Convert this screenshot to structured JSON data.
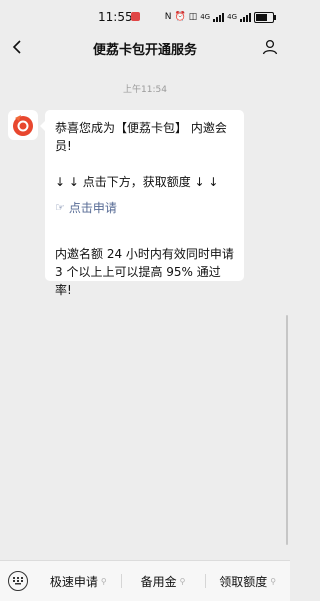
{
  "status_bar": {
    "time": "11:55",
    "network": "4G",
    "network2": "4G"
  },
  "nav": {
    "title": "便荔卡包开通服务"
  },
  "chat": {
    "timestamp": "上午11:54",
    "message": {
      "line1": "恭喜您成为【便荔卡包】 内邀会员!",
      "line2": "↓ ↓ 点击下方，获取额度 ↓ ↓",
      "link_text": "点击申请",
      "line3": "内邀名额 24 小时内有效同时申请 3 个以上上可以提高 95% 通过率!"
    }
  },
  "menu": {
    "items": [
      {
        "label": "极速申请"
      },
      {
        "label": "备用金"
      },
      {
        "label": "领取额度"
      }
    ]
  },
  "colors": {
    "background": "#ededed",
    "link": "#576b95",
    "brand": "#e8472f"
  }
}
